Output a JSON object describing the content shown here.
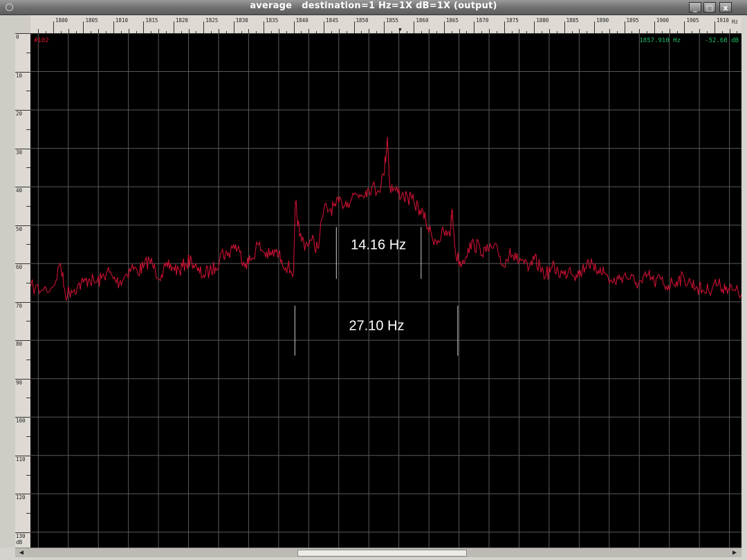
{
  "window": {
    "title": "average   destination=1 Hz=1X dB=1X (output)",
    "minimize_label": "_",
    "maximize_label": "□",
    "close_label": "x"
  },
  "readouts": {
    "trace_id": "#102",
    "cursor_freq": "1857.910 Hz",
    "cursor_level": "-52.68 dB"
  },
  "annotations": {
    "inner_width": "14.16 Hz",
    "outer_width": "27.10 Hz"
  },
  "colors": {
    "trace": "#cc1133",
    "trace_id": "#e01030",
    "readout": "#1fbf6a",
    "grid": "#5a5a5a",
    "background": "#000000"
  },
  "chart_data": {
    "type": "line",
    "xunit": "Hz",
    "yunit": "dB",
    "xlim": [
      1796.2,
      1914.5
    ],
    "ylim": [
      0,
      134
    ],
    "x_ticks": [
      1800,
      1805,
      1810,
      1815,
      1820,
      1825,
      1830,
      1835,
      1840,
      1845,
      1850,
      1855,
      1860,
      1865,
      1870,
      1875,
      1880,
      1885,
      1890,
      1895,
      1900,
      1905,
      1910
    ],
    "y_ticks": [
      0,
      10,
      20,
      30,
      40,
      50,
      60,
      70,
      80,
      90,
      100,
      110,
      120,
      130
    ],
    "grid": true,
    "series": [
      {
        "x": [
          1796.2,
          1798,
          1800,
          1801.2,
          1802,
          1803,
          1804,
          1805,
          1806,
          1807,
          1808,
          1809,
          1810,
          1811,
          1812,
          1813,
          1814,
          1815,
          1816,
          1817,
          1818,
          1819,
          1820,
          1821,
          1822,
          1823,
          1824,
          1825,
          1826,
          1827,
          1828,
          1829,
          1830,
          1831,
          1832,
          1833,
          1834,
          1835,
          1836,
          1837,
          1838,
          1839,
          1840,
          1840.3,
          1841,
          1842,
          1843,
          1844,
          1845,
          1846,
          1847,
          1848,
          1849,
          1850,
          1851,
          1852,
          1853,
          1854,
          1855,
          1855.6,
          1856,
          1857,
          1858,
          1859,
          1860,
          1861,
          1862,
          1863,
          1864,
          1865,
          1866,
          1866.3,
          1867,
          1868,
          1869,
          1870,
          1871,
          1872,
          1873,
          1874,
          1875,
          1876,
          1877,
          1878,
          1879,
          1880,
          1881,
          1882,
          1883,
          1884,
          1885,
          1886,
          1887,
          1888,
          1889,
          1890,
          1891,
          1892,
          1893,
          1894,
          1895,
          1896,
          1897,
          1898,
          1899,
          1900,
          1901,
          1902,
          1903,
          1904,
          1905,
          1906,
          1907,
          1908,
          1909,
          1910,
          1911,
          1912,
          1913,
          1914.5
        ],
        "y": [
          66,
          67,
          66,
          60,
          68,
          67,
          66,
          65,
          64,
          65,
          64,
          62,
          64,
          65,
          63,
          61,
          62,
          61,
          59,
          62,
          63,
          61,
          61,
          62,
          60,
          59,
          62,
          63,
          62,
          61,
          57,
          58,
          55,
          57,
          60,
          59,
          55,
          57,
          58,
          57,
          59,
          61,
          62,
          44,
          53,
          55,
          54,
          56,
          46,
          46,
          45,
          44,
          44,
          42,
          42,
          41,
          40,
          41,
          37,
          27,
          40,
          41,
          42,
          43,
          44,
          46,
          49,
          53,
          54,
          52,
          53,
          46,
          58,
          60,
          56,
          55,
          56,
          57,
          56,
          57,
          61,
          56,
          59,
          59,
          62,
          59,
          61,
          63,
          61,
          62,
          63,
          61,
          63,
          62,
          59,
          62,
          61,
          63,
          65,
          64,
          63,
          64,
          65,
          65,
          63,
          65,
          64,
          66,
          65,
          64,
          64,
          65,
          66,
          67,
          67,
          65,
          66,
          66,
          67,
          68
        ]
      }
    ]
  }
}
